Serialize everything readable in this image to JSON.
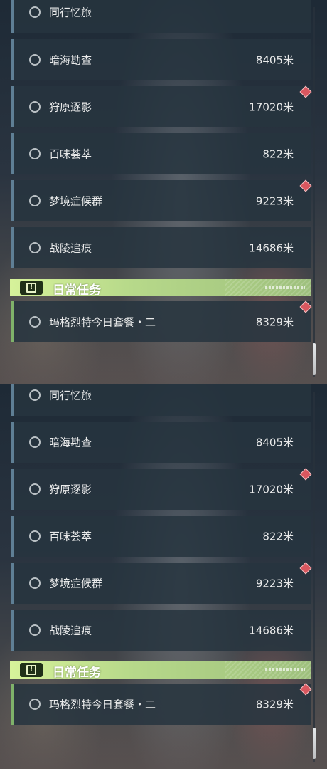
{
  "missions": [
    {
      "name": "同行忆旅",
      "distance": "",
      "marked": false
    },
    {
      "name": "暗海勘查",
      "distance": "8405米",
      "marked": false
    },
    {
      "name": "狩原逐影",
      "distance": "17020米",
      "marked": true
    },
    {
      "name": "百味荟萃",
      "distance": "822米",
      "marked": false
    },
    {
      "name": "梦境症候群",
      "distance": "9223米",
      "marked": true
    },
    {
      "name": "战陵追痕",
      "distance": "14686米",
      "marked": false
    }
  ],
  "daily_section": {
    "title": "日常任务",
    "mission": {
      "name": "玛格烈特今日套餐・二",
      "distance": "8329米",
      "marked": true
    }
  },
  "colors": {
    "section_header": "#c8e68e",
    "marker": "#d9575f",
    "row_bg": "#26343f"
  }
}
